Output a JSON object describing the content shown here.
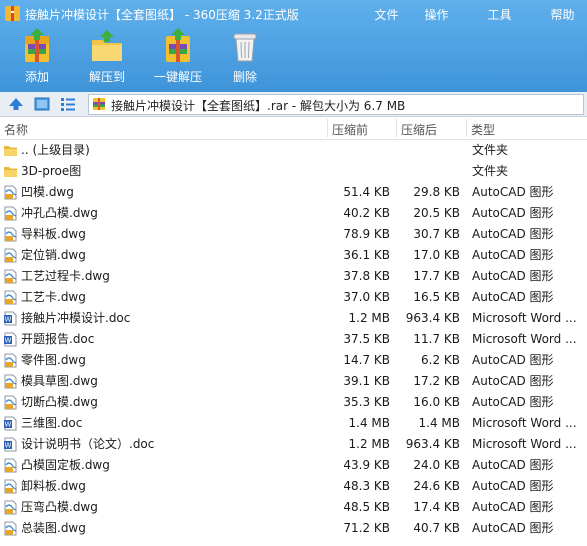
{
  "window": {
    "title": "接触片冲模设计【全套图纸】 - 360压缩 3.2正式版",
    "menu": [
      "文件",
      "操作",
      "工具",
      "帮助"
    ]
  },
  "toolbar": {
    "add_label": "添加",
    "extract_label": "解压到",
    "one_click_label": "一键解压",
    "delete_label": "删除"
  },
  "address": {
    "text": "接触片冲模设计【全套图纸】.rar - 解包大小为 6.7 MB"
  },
  "columns": {
    "name": "名称",
    "packed": "压缩前",
    "compressed": "压缩后",
    "type": "类型"
  },
  "files": [
    {
      "icon": "folder",
      "name": ".. (上级目录)",
      "packed": "",
      "compressed": "",
      "type": "文件夹"
    },
    {
      "icon": "folder",
      "name": "3D-proe图",
      "packed": "",
      "compressed": "",
      "type": "文件夹"
    },
    {
      "icon": "dwg",
      "name": "凹模.dwg",
      "packed": "51.4 KB",
      "compressed": "29.8 KB",
      "type": "AutoCAD 图形"
    },
    {
      "icon": "dwg",
      "name": "冲孔凸模.dwg",
      "packed": "40.2 KB",
      "compressed": "20.5 KB",
      "type": "AutoCAD 图形"
    },
    {
      "icon": "dwg",
      "name": "导料板.dwg",
      "packed": "78.9 KB",
      "compressed": "30.7 KB",
      "type": "AutoCAD 图形"
    },
    {
      "icon": "dwg",
      "name": "定位销.dwg",
      "packed": "36.1 KB",
      "compressed": "17.0 KB",
      "type": "AutoCAD 图形"
    },
    {
      "icon": "dwg",
      "name": "工艺过程卡.dwg",
      "packed": "37.8 KB",
      "compressed": "17.7 KB",
      "type": "AutoCAD 图形"
    },
    {
      "icon": "dwg",
      "name": "工艺卡.dwg",
      "packed": "37.0 KB",
      "compressed": "16.5 KB",
      "type": "AutoCAD 图形"
    },
    {
      "icon": "doc",
      "name": "接触片冲模设计.doc",
      "packed": "1.2 MB",
      "compressed": "963.4 KB",
      "type": "Microsoft Word ..."
    },
    {
      "icon": "doc",
      "name": "开题报告.doc",
      "packed": "37.5 KB",
      "compressed": "11.7 KB",
      "type": "Microsoft Word ..."
    },
    {
      "icon": "dwg",
      "name": "零件图.dwg",
      "packed": "14.7 KB",
      "compressed": "6.2 KB",
      "type": "AutoCAD 图形"
    },
    {
      "icon": "dwg",
      "name": "模具草图.dwg",
      "packed": "39.1 KB",
      "compressed": "17.2 KB",
      "type": "AutoCAD 图形"
    },
    {
      "icon": "dwg",
      "name": "切断凸模.dwg",
      "packed": "35.3 KB",
      "compressed": "16.0 KB",
      "type": "AutoCAD 图形"
    },
    {
      "icon": "doc",
      "name": "三维图.doc",
      "packed": "1.4 MB",
      "compressed": "1.4 MB",
      "type": "Microsoft Word ..."
    },
    {
      "icon": "doc",
      "name": "设计说明书（论文）.doc",
      "packed": "1.2 MB",
      "compressed": "963.4 KB",
      "type": "Microsoft Word ..."
    },
    {
      "icon": "dwg",
      "name": "凸模固定板.dwg",
      "packed": "43.9 KB",
      "compressed": "24.0 KB",
      "type": "AutoCAD 图形"
    },
    {
      "icon": "dwg",
      "name": "卸料板.dwg",
      "packed": "48.3 KB",
      "compressed": "24.6 KB",
      "type": "AutoCAD 图形"
    },
    {
      "icon": "dwg",
      "name": "压弯凸模.dwg",
      "packed": "48.5 KB",
      "compressed": "17.4 KB",
      "type": "AutoCAD 图形"
    },
    {
      "icon": "dwg",
      "name": "总装图.dwg",
      "packed": "71.2 KB",
      "compressed": "40.7 KB",
      "type": "AutoCAD 图形"
    }
  ]
}
